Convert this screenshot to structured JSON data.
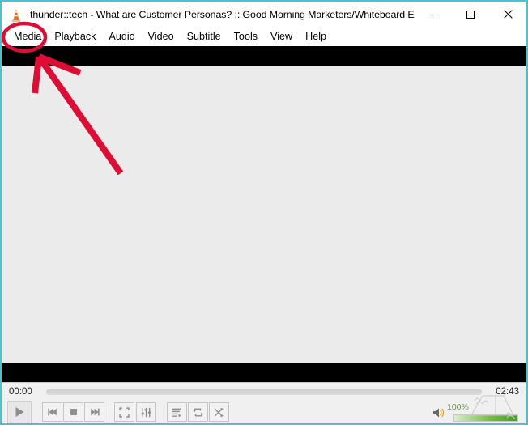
{
  "window": {
    "title": "thunder::tech - What are Customer Personas? :: Good Morning Marketers/Whiteboard Edi...",
    "app_icon": "vlc-cone-icon",
    "controls": {
      "minimize": "minimize-icon",
      "maximize": "maximize-icon",
      "close": "close-icon"
    }
  },
  "menu_bar": {
    "items": [
      {
        "label": "Media"
      },
      {
        "label": "Playback"
      },
      {
        "label": "Audio"
      },
      {
        "label": "Video"
      },
      {
        "label": "Subtitle"
      },
      {
        "label": "Tools"
      },
      {
        "label": "View"
      },
      {
        "label": "Help"
      }
    ]
  },
  "player": {
    "time_elapsed": "00:00",
    "time_total": "02:43",
    "seek_position_percent": 0,
    "volume_label": "100%",
    "volume_percent": 100,
    "buttons": [
      {
        "name": "play-button",
        "icon": "play-icon",
        "label": "Play"
      },
      {
        "name": "prev-button",
        "icon": "previous-track-icon",
        "label": "Previous"
      },
      {
        "name": "stop-button",
        "icon": "stop-icon",
        "label": "Stop"
      },
      {
        "name": "next-button",
        "icon": "next-track-icon",
        "label": "Next"
      },
      {
        "name": "fullscreen-button",
        "icon": "fullscreen-icon",
        "label": "Toggle fullscreen"
      },
      {
        "name": "extended-settings-button",
        "icon": "equalizer-sliders-icon",
        "label": "Show extended settings"
      },
      {
        "name": "playlist-button",
        "icon": "playlist-icon",
        "label": "Show playlist"
      },
      {
        "name": "loop-button",
        "icon": "loop-icon",
        "label": "Loop"
      },
      {
        "name": "shuffle-button",
        "icon": "shuffle-icon",
        "label": "Random"
      }
    ]
  },
  "annotations": {
    "highlight_color": "#dd0d35",
    "circle_target": "Media",
    "arrow": "arrow-pointing-to-media-menu"
  }
}
